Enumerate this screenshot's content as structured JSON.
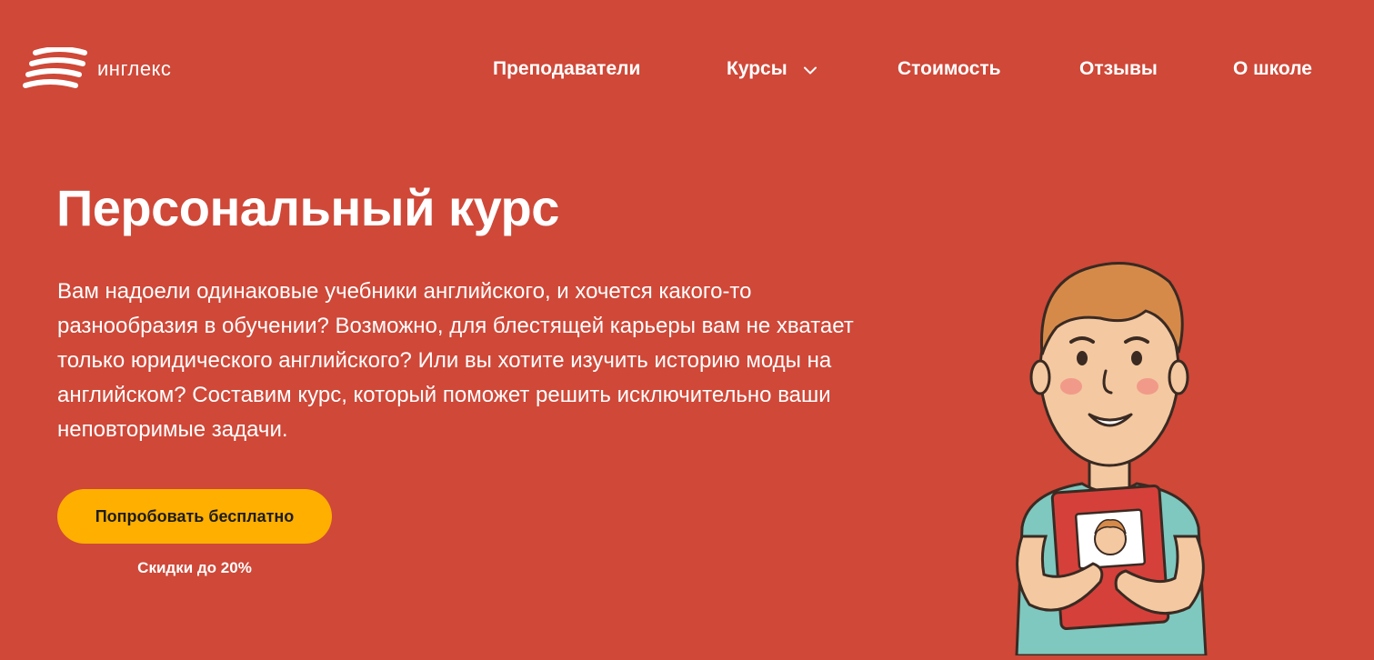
{
  "brand": {
    "name": "инглекс"
  },
  "nav": {
    "items": [
      {
        "label": "Преподаватели"
      },
      {
        "label": "Курсы"
      },
      {
        "label": "Стоимость"
      },
      {
        "label": "Отзывы"
      },
      {
        "label": "О школе"
      }
    ]
  },
  "hero": {
    "title": "Персональный курс",
    "description": "Вам надоели одинаковые учебники английского, и хочется какого-то разнообразия в обучении? Возможно, для блестящей карьеры вам не хватает только юридического английского? Или вы хотите изучить историю моды на английском? Составим курс, который поможет решить исключительно ваши неповторимые задачи.",
    "cta_label": "Попробовать бесплатно",
    "discount": "Скидки до 20%"
  },
  "colors": {
    "background": "#cf4838",
    "cta": "#ffaf00",
    "text": "#ffffff"
  },
  "icons": {
    "logo": "englex-waves-logo",
    "dropdown": "chevron-down-icon"
  }
}
